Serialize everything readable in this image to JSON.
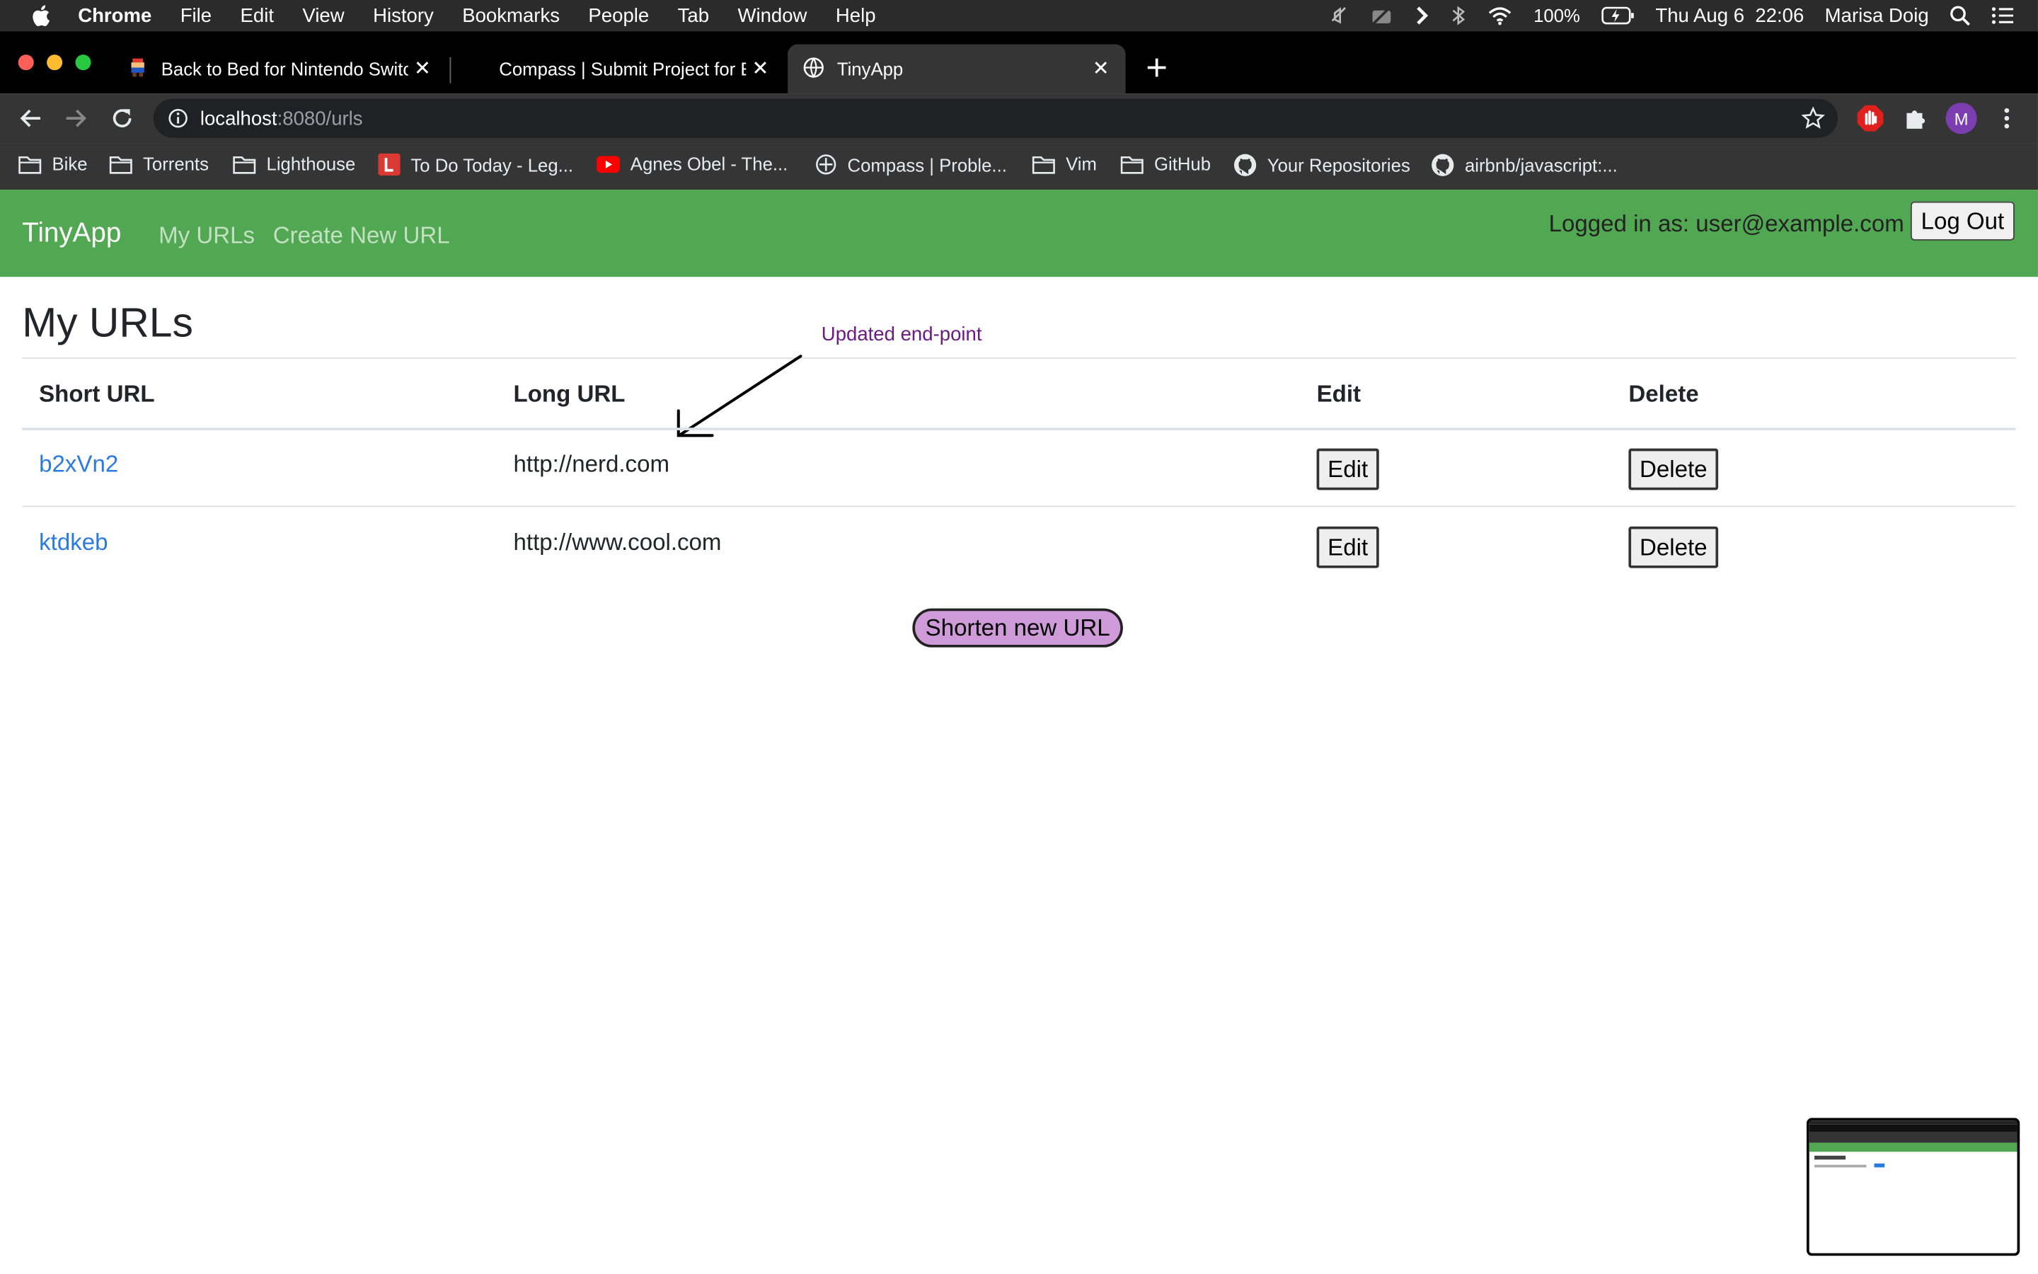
{
  "menubar": {
    "app": "Chrome",
    "items": [
      "File",
      "Edit",
      "View",
      "History",
      "Bookmarks",
      "People",
      "Tab",
      "Window",
      "Help"
    ],
    "battery": "100%",
    "datetime": "Thu Aug 6  22:06",
    "user": "Marisa Doig"
  },
  "tabs": [
    {
      "label": "Back to Bed for Nintendo Switc"
    },
    {
      "label": "Compass | Submit Project for E"
    },
    {
      "label": "TinyApp"
    }
  ],
  "address": {
    "host": "localhost",
    "path": ":8080/urls"
  },
  "profile_initial": "M",
  "bookmarks": [
    "Bike",
    "Torrents",
    "Lighthouse",
    "To Do Today - Leg...",
    "Agnes Obel - The...",
    "Compass | Proble...",
    "Vim",
    "GitHub",
    "Your Repositories",
    "airbnb/javascript:..."
  ],
  "app": {
    "brand": "TinyApp",
    "nav": {
      "my_urls": "My URLs",
      "create": "Create New URL"
    },
    "logged_in": "Logged in as: user@example.com",
    "logout": "Log Out"
  },
  "page": {
    "title": "My URLs",
    "annotation": "Updated end-point",
    "headers": {
      "short": "Short URL",
      "long": "Long URL",
      "edit": "Edit",
      "delete": "Delete"
    },
    "rows": [
      {
        "short": "b2xVn2",
        "long": "http://nerd.com",
        "edit": "Edit",
        "delete": "Delete"
      },
      {
        "short": "ktdkeb",
        "long": "http://www.cool.com",
        "edit": "Edit",
        "delete": "Delete"
      }
    ],
    "shorten": "Shorten new URL"
  },
  "colors": {
    "navbar": "#52a752",
    "link": "#2a7ae2",
    "shorten_button": "#cf9ad8",
    "annotation": "#6a1b82"
  }
}
